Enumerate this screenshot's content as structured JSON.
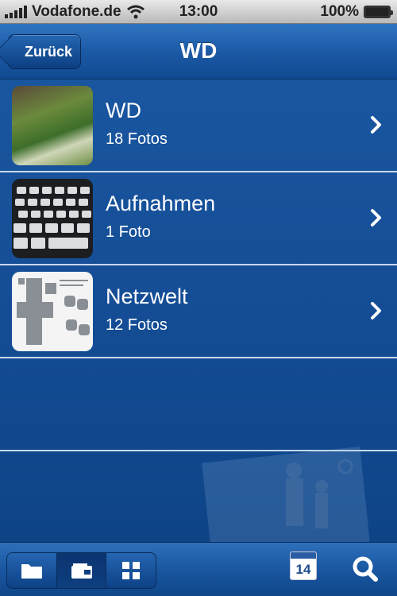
{
  "status_bar": {
    "carrier": "Vodafone.de",
    "time": "13:00",
    "battery": "100%"
  },
  "nav": {
    "back_label": "Zurück",
    "title": "WD"
  },
  "albums": [
    {
      "title": "WD",
      "subtitle": "18 Fotos"
    },
    {
      "title": "Aufnahmen",
      "subtitle": "1 Foto"
    },
    {
      "title": "Netzwelt",
      "subtitle": "12 Fotos"
    }
  ],
  "toolbar": {
    "calendar_day": "14",
    "segments": [
      "folder-icon",
      "wallet-icon",
      "grid-icon"
    ],
    "active_segment": "wallet-icon"
  },
  "colors": {
    "accent": "#134b93",
    "separator": "#c9d8ec",
    "status_bar": "#d0d0d0"
  }
}
